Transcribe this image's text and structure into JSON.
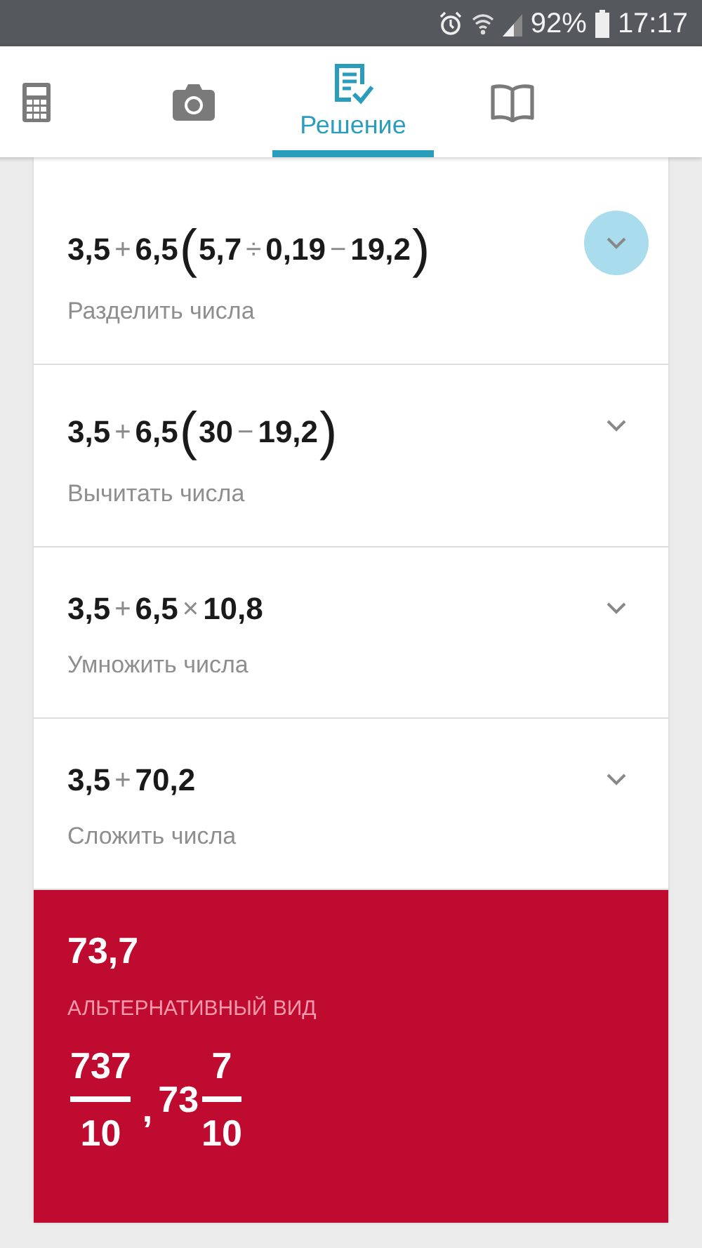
{
  "status_bar": {
    "battery": "92%",
    "time": "17:17"
  },
  "tabs": [
    {
      "kind": "calculator",
      "selected": false
    },
    {
      "kind": "camera",
      "selected": false
    },
    {
      "kind": "solution",
      "label": "Решение",
      "selected": true
    },
    {
      "kind": "book",
      "selected": false
    }
  ],
  "steps": [
    {
      "expression": [
        {
          "kind": "num",
          "text": "3,5"
        },
        {
          "kind": "op",
          "text": "+"
        },
        {
          "kind": "num",
          "text": "6,5"
        },
        {
          "kind": "paren",
          "text": "("
        },
        {
          "kind": "num",
          "text": "5,7"
        },
        {
          "kind": "op",
          "text": "÷"
        },
        {
          "kind": "num",
          "text": "0,19"
        },
        {
          "kind": "op",
          "text": "−"
        },
        {
          "kind": "num",
          "text": "19,2"
        },
        {
          "kind": "paren",
          "text": ")"
        }
      ],
      "description": "Разделить числа",
      "active": true
    },
    {
      "expression": [
        {
          "kind": "num",
          "text": "3,5"
        },
        {
          "kind": "op",
          "text": "+"
        },
        {
          "kind": "num",
          "text": "6,5"
        },
        {
          "kind": "paren",
          "text": "("
        },
        {
          "kind": "num",
          "text": "30"
        },
        {
          "kind": "op",
          "text": "−"
        },
        {
          "kind": "num",
          "text": "19,2"
        },
        {
          "kind": "paren",
          "text": ")"
        }
      ],
      "description": "Вычитать числа",
      "active": false
    },
    {
      "expression": [
        {
          "kind": "num",
          "text": "3,5"
        },
        {
          "kind": "op",
          "text": "+"
        },
        {
          "kind": "num",
          "text": "6,5"
        },
        {
          "kind": "op",
          "text": "×"
        },
        {
          "kind": "num",
          "text": "10,8"
        }
      ],
      "description": "Умножить числа",
      "active": false
    },
    {
      "expression": [
        {
          "kind": "num",
          "text": "3,5"
        },
        {
          "kind": "op",
          "text": "+"
        },
        {
          "kind": "num",
          "text": "70,2"
        }
      ],
      "description": "Сложить числа",
      "active": false
    }
  ],
  "result": {
    "value": "73,7",
    "label": "АЛЬТЕРНАТИВНЫЙ ВИД",
    "separator": ",",
    "alternatives": [
      {
        "kind": "fraction",
        "numerator": "737",
        "denominator": "10"
      },
      {
        "kind": "mixed",
        "whole": "73",
        "numerator": "7",
        "denominator": "10"
      }
    ]
  }
}
